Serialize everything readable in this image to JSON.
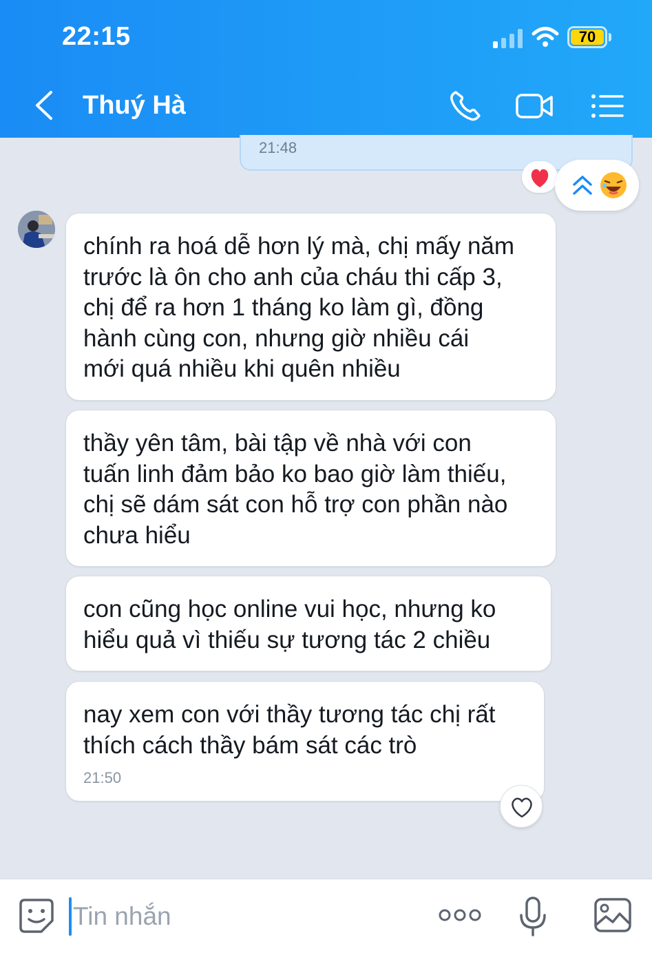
{
  "status_bar": {
    "time": "22:15",
    "battery": "70"
  },
  "header": {
    "title": "Thuý Hà"
  },
  "previous_message": {
    "time": "21:48"
  },
  "messages": [
    {
      "lines": [
        "chính ra hoá dễ hơn lý mà, chị mấy năm",
        "trước là ôn cho anh của cháu thi cấp 3,",
        "chị để ra hơn 1 tháng ko làm gì, đồng",
        "hành cùng con, nhưng giờ nhiều cái",
        "mới quá nhiều khi quên nhiều"
      ]
    },
    {
      "lines": [
        "thầy yên tâm, bài tập về nhà với con",
        "tuấn linh đảm bảo ko bao giờ làm thiếu,",
        "chị sẽ dám sát con hỗ trợ con phần nào",
        "chưa hiểu"
      ]
    },
    {
      "lines": [
        "con cũng học online vui học, nhưng ko",
        "hiểu quả vì thiếu sự tương tác 2 chiều"
      ]
    },
    {
      "lines": [
        "nay xem con với thầy tương tác chị rất",
        "thích cách thầy bám sát các trò"
      ],
      "time": "21:50"
    }
  ],
  "composer": {
    "placeholder": "Tin nhắn"
  },
  "icons": {
    "back": "chevron-left-icon",
    "call": "phone-icon",
    "video": "video-camera-icon",
    "menu": "list-menu-icon",
    "reaction_heart": "red-heart-icon",
    "scroll_up": "double-chevron-up-icon",
    "reaction_laugh": "laughing-face-icon",
    "like": "heart-outline-icon",
    "sticker": "smiley-sticker-icon",
    "more": "more-dots-icon",
    "mic": "microphone-icon",
    "image": "image-icon"
  },
  "colors": {
    "header_start": "#1a8cf5",
    "header_end": "#21a8f9",
    "background": "#e2e7ef",
    "accent": "#1a8cf5",
    "battery": "#ffd60a",
    "heart": "#f0314a"
  }
}
